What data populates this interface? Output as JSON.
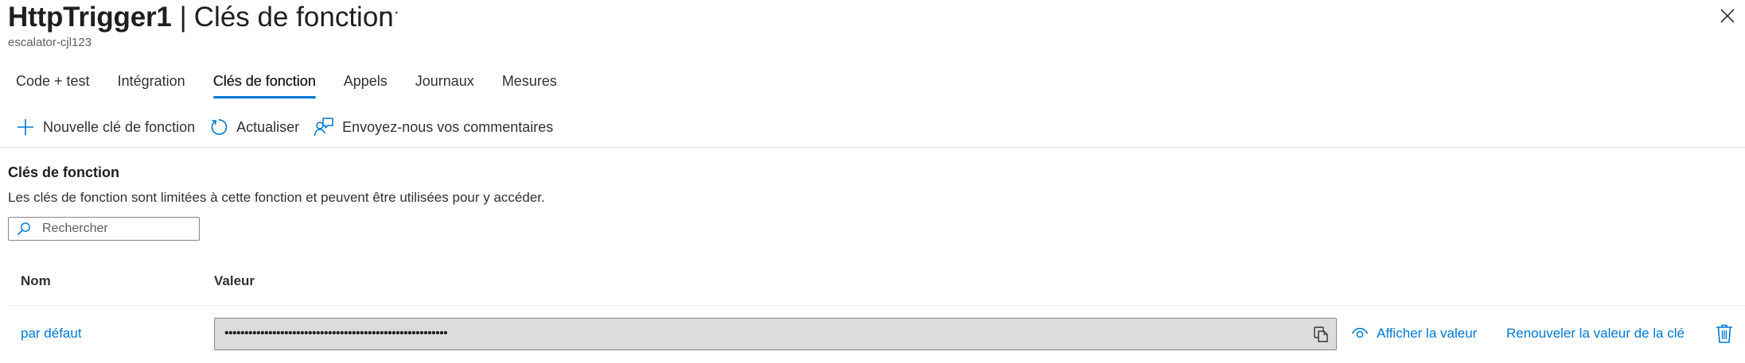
{
  "header": {
    "title": "HttpTrigger1",
    "separator": "|",
    "subtitle": "Clés de fonction",
    "more_label": "···",
    "resource": "escalator-cjl123"
  },
  "tabs": [
    {
      "label": "Code + test",
      "active": false
    },
    {
      "label": "Intégration",
      "active": false
    },
    {
      "label": "Clés de fonction",
      "active": true
    },
    {
      "label": "Appels",
      "active": false
    },
    {
      "label": "Journaux",
      "active": false
    },
    {
      "label": "Mesures",
      "active": false
    }
  ],
  "toolbar": {
    "new_key": "Nouvelle clé de fonction",
    "refresh": "Actualiser",
    "feedback": "Envoyez-nous vos commentaires"
  },
  "section": {
    "title": "Clés de fonction",
    "description": "Les clés de fonction sont limitées à cette fonction et peuvent être utilisées pour y accéder."
  },
  "search": {
    "placeholder": "Rechercher",
    "value": ""
  },
  "table": {
    "columns": {
      "name": "Nom",
      "value": "Valeur"
    },
    "rows": [
      {
        "name": "par défaut",
        "value_masked": "••••••••••••••••••••••••••••••••••••••••••••••••••••••••",
        "show_label": "Afficher la valeur",
        "renew_label": "Renouveler la valeur de la clé"
      }
    ]
  },
  "colors": {
    "accent": "#0078d4",
    "text": "#323130",
    "value_box": "#dcdcdc"
  }
}
